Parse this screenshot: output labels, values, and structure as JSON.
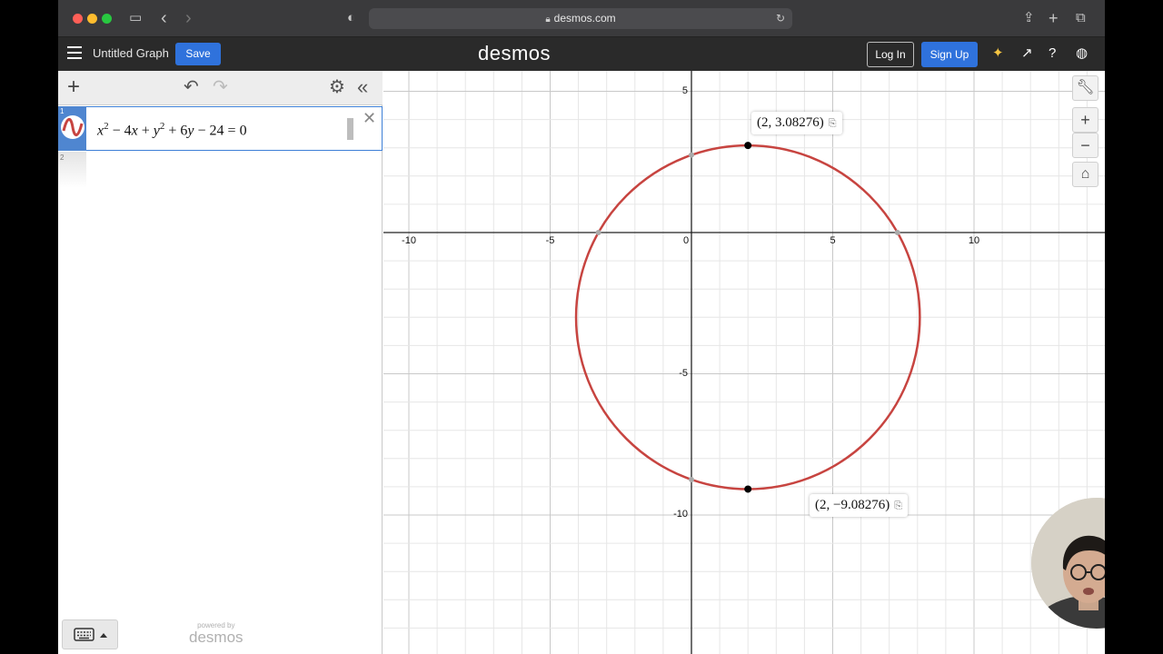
{
  "browser": {
    "url": "desmos.com",
    "nav_back": "‹",
    "nav_forward": "›"
  },
  "header": {
    "graph_title": "Untitled Graph",
    "save_label": "Save",
    "logo": "desmos",
    "login_label": "Log In",
    "signup_label": "Sign Up"
  },
  "expressions": [
    {
      "index": "1",
      "latex_text": "x² − 4x + y² + 6y − 24 = 0",
      "color": "#c74440"
    },
    {
      "index": "2"
    }
  ],
  "powered": {
    "small": "powered by",
    "big": "desmos"
  },
  "graph": {
    "x_ticks": [
      "-10",
      "-5",
      "0",
      "5",
      "10"
    ],
    "y_ticks": [
      "5",
      "-5",
      "-10"
    ],
    "curve_color": "#c74440",
    "points": [
      {
        "label": "(2, 3.08276)",
        "x": 2,
        "y": 3.08276
      },
      {
        "label": "(2, −9.08276)",
        "x": 2,
        "y": -9.08276
      }
    ],
    "circle": {
      "center_x": 2,
      "center_y": -3,
      "radius": 6.08276
    }
  }
}
